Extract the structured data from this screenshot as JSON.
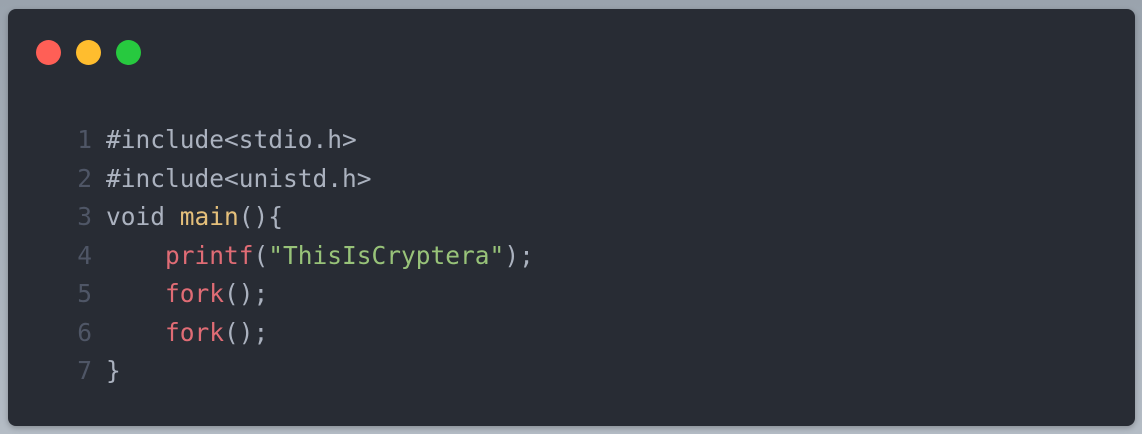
{
  "window": {
    "controls": [
      {
        "name": "close",
        "color": "#ff5f56"
      },
      {
        "name": "minimize",
        "color": "#ffbd2e"
      },
      {
        "name": "zoom",
        "color": "#27c93f"
      }
    ]
  },
  "code": {
    "language": "c",
    "lines": [
      {
        "num": "1",
        "tokens": [
          {
            "t": "plain",
            "v": "#include<stdio.h>"
          }
        ]
      },
      {
        "num": "2",
        "tokens": [
          {
            "t": "plain",
            "v": "#include<unistd.h>"
          }
        ]
      },
      {
        "num": "3",
        "tokens": [
          {
            "t": "plain",
            "v": "void "
          },
          {
            "t": "func",
            "v": "main"
          },
          {
            "t": "plain",
            "v": "(){"
          }
        ]
      },
      {
        "num": "4",
        "tokens": [
          {
            "t": "plain",
            "v": "    "
          },
          {
            "t": "call",
            "v": "printf"
          },
          {
            "t": "plain",
            "v": "("
          },
          {
            "t": "str",
            "v": "\"ThisIsCryptera\""
          },
          {
            "t": "plain",
            "v": ");"
          }
        ]
      },
      {
        "num": "5",
        "tokens": [
          {
            "t": "plain",
            "v": "    "
          },
          {
            "t": "call",
            "v": "fork"
          },
          {
            "t": "plain",
            "v": "();"
          }
        ]
      },
      {
        "num": "6",
        "tokens": [
          {
            "t": "plain",
            "v": "    "
          },
          {
            "t": "call",
            "v": "fork"
          },
          {
            "t": "plain",
            "v": "();"
          }
        ]
      },
      {
        "num": "7",
        "tokens": [
          {
            "t": "plain",
            "v": "}"
          }
        ]
      }
    ]
  }
}
